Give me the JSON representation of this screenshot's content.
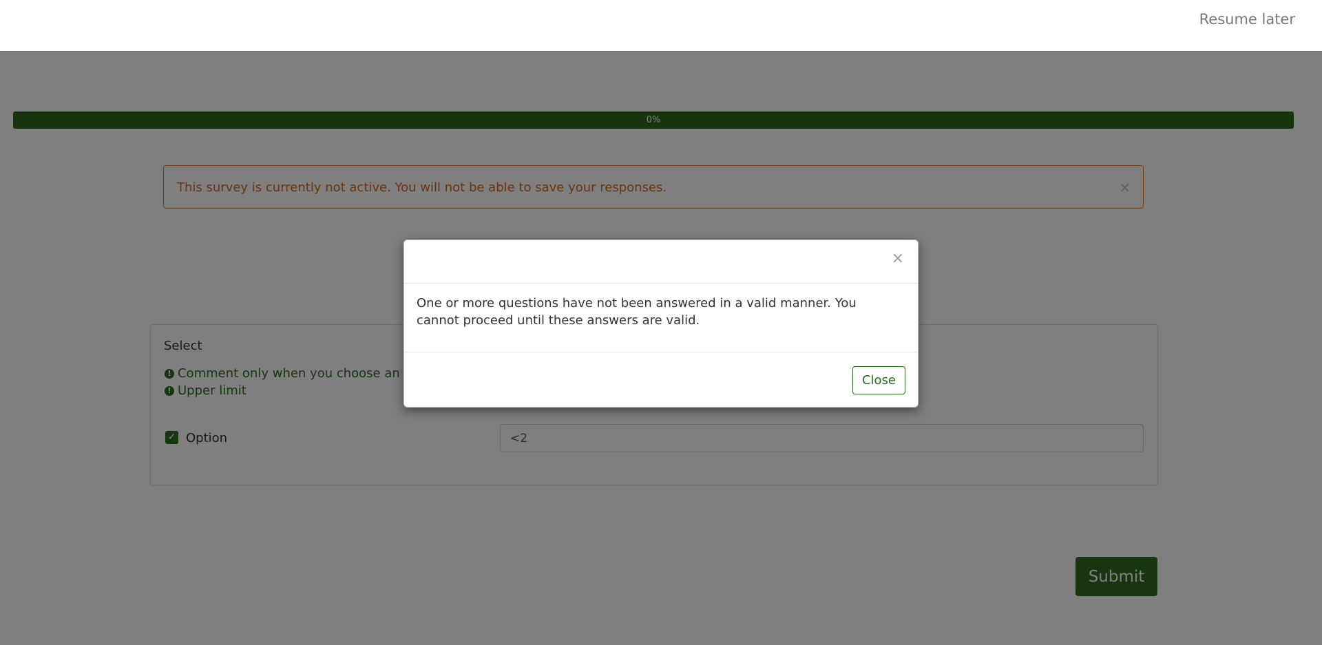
{
  "header": {
    "resume_later_label": "Resume later"
  },
  "progress": {
    "label": "0%",
    "value": 0
  },
  "alert": {
    "message": "This survey is currently not active. You will not be able to save your responses.",
    "close_glyph": "×"
  },
  "question": {
    "title": "Select",
    "tips": [
      "Comment only when you choose an answer",
      "Upper limit"
    ],
    "option": {
      "label": "Option",
      "checked": true,
      "comment_value": "<2"
    }
  },
  "submit_label": "Submit",
  "modal": {
    "close_glyph": "×",
    "message": "One or more questions have not been answered in a valid manner. You cannot proceed until these answers are valid.",
    "close_button_label": "Close"
  },
  "colors": {
    "accent": "#2e6b1e",
    "warning": "#d2691e"
  }
}
